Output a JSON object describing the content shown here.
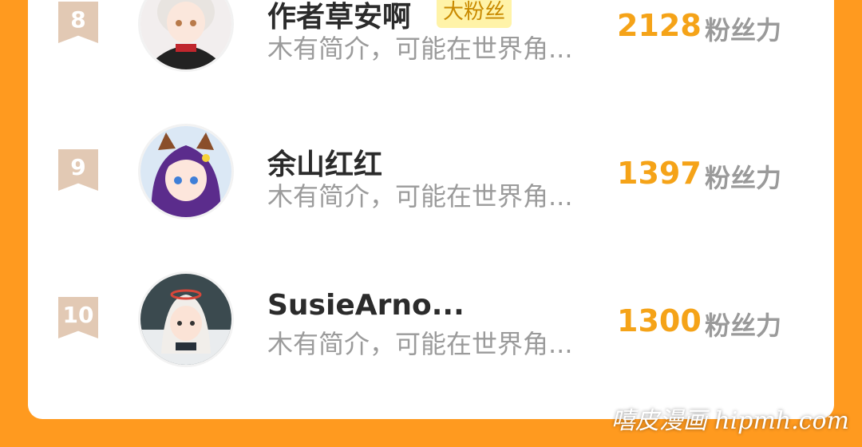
{
  "rows": [
    {
      "rank": "8",
      "name": "作者草安啊",
      "badge": "大粉丝",
      "desc": "木有简介，可能在世界角...",
      "score": "2128",
      "unit": "粉丝力"
    },
    {
      "rank": "9",
      "name": "余山红红",
      "badge": "",
      "desc": "木有简介，可能在世界角...",
      "score": "1397",
      "unit": "粉丝力"
    },
    {
      "rank": "10",
      "name": "SusieArno...",
      "badge": "",
      "desc": "木有简介，可能在世界角...",
      "score": "1300",
      "unit": "粉丝力"
    }
  ],
  "watermark": "嘻皮漫画 hipmh.com",
  "colors": {
    "background": "#ff9a1f",
    "score": "#f5a318",
    "badge_bg": "#fff3a8",
    "rank_ribbon": "#e2c9b4"
  }
}
